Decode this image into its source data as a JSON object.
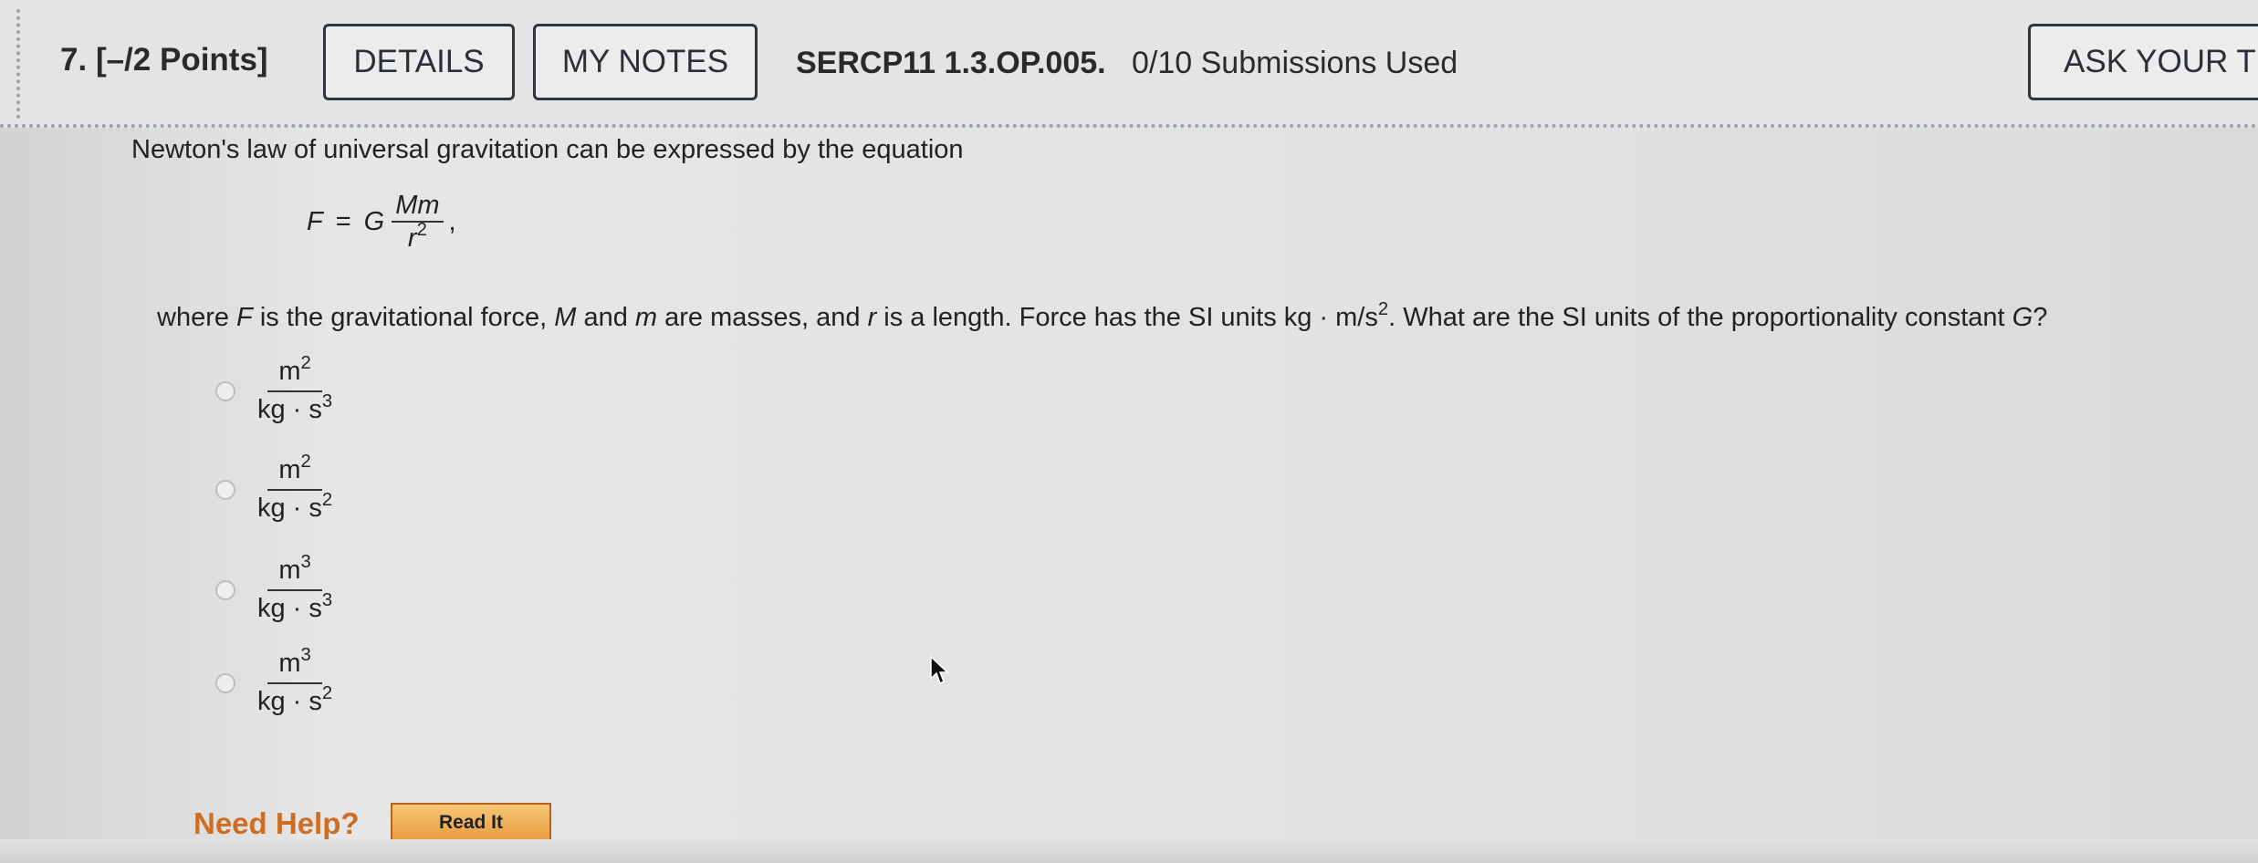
{
  "header": {
    "question_number": "7.",
    "points": "[–/2 Points]",
    "details_button": "DETAILS",
    "notes_button": "MY NOTES",
    "problem_code": "SERCP11 1.3.OP.005.",
    "submissions": "0/10 Submissions Used",
    "ask_button": "ASK YOUR TEA"
  },
  "problem": {
    "intro": "Newton's law of universal gravitation can be expressed by the equation",
    "equation": {
      "lhs": "F",
      "equals": "=",
      "constant": "G",
      "numerator": "Mm",
      "denominator_base": "r",
      "denominator_exp": "2",
      "trailing": ","
    },
    "question": {
      "t1": "where ",
      "F": "F",
      "t2": " is the gravitational force, ",
      "M": "M",
      "t3": " and ",
      "m": "m",
      "t4": " are masses, and ",
      "r": "r",
      "t5": " is a length. Force has the SI units kg · m/s",
      "sup": "2",
      "t6": ". What are the SI units of the proportionality constant ",
      "G": "G",
      "t7": "?"
    }
  },
  "options": [
    {
      "num_base": "m",
      "num_exp": "2",
      "den_base": "kg · s",
      "den_exp": "3"
    },
    {
      "num_base": "m",
      "num_exp": "2",
      "den_base": "kg · s",
      "den_exp": "2"
    },
    {
      "num_base": "m",
      "num_exp": "3",
      "den_base": "kg · s",
      "den_exp": "3"
    },
    {
      "num_base": "m",
      "num_exp": "3",
      "den_base": "kg · s",
      "den_exp": "2"
    }
  ],
  "help": {
    "label": "Need Help?",
    "read_it": "Read It"
  },
  "colors": {
    "help_text": "#cf6e22",
    "read_it_fill": "#f0b055",
    "border_dark": "#2d3540"
  }
}
